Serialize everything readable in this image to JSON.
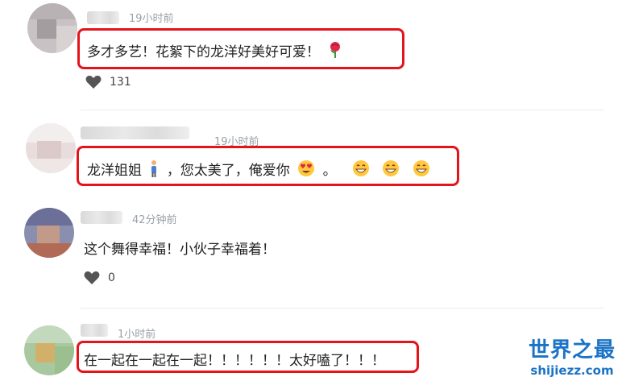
{
  "comments": [
    {
      "time": "19小时前",
      "text": "多才多艺！花絮下的龙洋好美好可爱！",
      "emoji": "rose-icon",
      "likes": "131"
    },
    {
      "time": "19小时前",
      "text_a": "龙洋姐姐",
      "text_b": "，您太美了，俺爱你",
      "text_c": "。",
      "emoji": [
        "person-icon",
        "heart-eyes-icon",
        "grinning-icon",
        "grinning-icon",
        "grinning-icon"
      ]
    },
    {
      "time": "42分钟前",
      "text": "这个舞得幸福！小伙子幸福着！",
      "likes": "0"
    },
    {
      "time": "1小时前",
      "text": "在一起在一起在一起！！！！！！太好嗑了！！！"
    }
  ],
  "watermark": {
    "title": "世界之最",
    "url": "shijiezz.com"
  },
  "colors": {
    "highlight": "#e3141a",
    "watermark": "#1a73c6",
    "time": "#9aa0a6"
  }
}
